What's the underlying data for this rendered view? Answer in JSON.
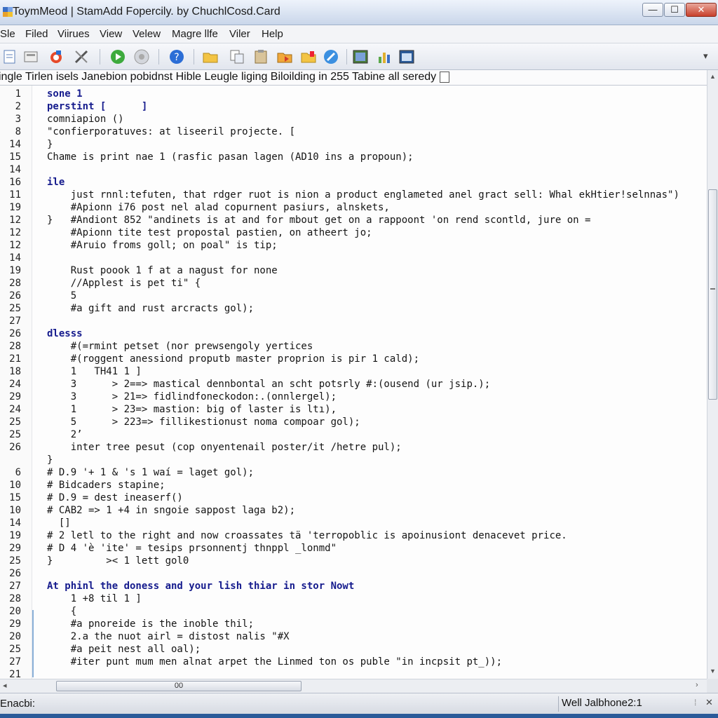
{
  "window": {
    "title": "ToymMeod | StamAdd Fopercily. by ChuchlCosd.Card",
    "btn_min": "—",
    "btn_max": "☐",
    "btn_close": "✕",
    "icon": "app-icon"
  },
  "menu": [
    "Sle",
    "Filed",
    "Viirues",
    "View",
    "Velew",
    "Magre llfe",
    "Viler",
    "Help"
  ],
  "toolbar": {
    "icons": [
      "new-file-icon",
      "open-file-icon",
      "refresh-icon",
      "tools-icon",
      "run-icon",
      "settings-icon",
      "help-icon",
      "folder-icon",
      "copy-icon",
      "paste-icon",
      "export-icon",
      "bookmark-icon",
      "edit-icon",
      "image-icon",
      "chart-icon",
      "window-icon"
    ],
    "more": "▾"
  },
  "pathbar": {
    "text": "ingle Tirlen isels Janebion pobidnst Hible Leugle liging Biloilding in 255 Tabine all seredy"
  },
  "editor": {
    "lines": [
      {
        "n": "1",
        "code": "sone 1",
        "kw": true
      },
      {
        "n": "2",
        "code": "perstint [      ]",
        "kw": true
      },
      {
        "n": "3",
        "code": "comniapion ()",
        "kw": false
      },
      {
        "n": "8",
        "code": "\"confierporatuves: at liseeril projecte. [",
        "kw": false
      },
      {
        "n": "14",
        "code": "}",
        "kw": false
      },
      {
        "n": "15",
        "code": "Chame is print nae 1 (rasfic pasan lagen (AD10 ins a propoun);",
        "kw": false
      },
      {
        "n": "14",
        "code": "",
        "kw": false
      },
      {
        "n": "16",
        "code": "ile",
        "kw": true
      },
      {
        "n": "11",
        "code": "    just rnnl:tefuten, that rdger ruot is nion a product englameted anel gract sell: Whal ekHtier!selnnas\")",
        "kw": false
      },
      {
        "n": "19",
        "code": "    #Apionn i76 post nel alad copurnent pasiurs, alnskets,",
        "kw": false
      },
      {
        "n": "12",
        "code": "}   #Andiont 852 \"andinets is at and for mbout get on a rappoont 'on rend scontld, jure on =",
        "kw": false
      },
      {
        "n": "12",
        "code": "    #Apionn tite test propostal pastien, on atheert jo;",
        "kw": false
      },
      {
        "n": "12",
        "code": "    #Aruio froms goll; on poal\" is tip;",
        "kw": false
      },
      {
        "n": "14",
        "code": "",
        "kw": false
      },
      {
        "n": "19",
        "code": "    Rust poook 1 f at a nagust for none",
        "kw": false
      },
      {
        "n": "28",
        "code": "    //Applest is pet ti\" {",
        "kw": false
      },
      {
        "n": "26",
        "code": "    5",
        "kw": false
      },
      {
        "n": "25",
        "code": "    #a gift and rust arcracts gol);",
        "kw": false
      },
      {
        "n": "27",
        "code": "",
        "kw": false
      },
      {
        "n": "26",
        "code": "dlesss",
        "kw": true
      },
      {
        "n": "28",
        "code": "    #(=rmint petset (nor prewsengoly yertices",
        "kw": false
      },
      {
        "n": "21",
        "code": "    #(roggent anessiond proputb master proprion is pir 1 cald);",
        "kw": false
      },
      {
        "n": "18",
        "code": "    1   TH41 1 ]",
        "kw": false
      },
      {
        "n": "24",
        "code": "    3      > 2==> mastical dennbontal an scht potsrly #:(ousend (ur jsip.);",
        "kw": false
      },
      {
        "n": "29",
        "code": "    3      > 21=> fidlindfoneckodon:.(onnlergel);",
        "kw": false
      },
      {
        "n": "24",
        "code": "    1      > 23=> mastion: big of laster is ltı),",
        "kw": false
      },
      {
        "n": "25",
        "code": "    5      > 223=> fillikestionust noma compoar gol);",
        "kw": false
      },
      {
        "n": "25",
        "code": "    2’",
        "kw": false
      },
      {
        "n": "26",
        "code": "    inter tree pesut (cop onyentenail poster/it /hetre pul);",
        "kw": false
      },
      {
        "n": "",
        "code": "}",
        "kw": false
      },
      {
        "n": "6",
        "code": "# D.9 '+ 1 & 's 1 waí = laget gol);",
        "kw": false
      },
      {
        "n": "10",
        "code": "# Bidcaders stapine;",
        "kw": false
      },
      {
        "n": "15",
        "code": "# D.9 = dest ineaserf()",
        "kw": false
      },
      {
        "n": "10",
        "code": "# CAB2 => 1 +4 in sngoie sappost laga b2);",
        "kw": false
      },
      {
        "n": "14",
        "code": "  []",
        "kw": false
      },
      {
        "n": "19",
        "code": "# 2 letl to the right and now croassates tä 'terropoblic is apoinusiont denacevet price.",
        "kw": false
      },
      {
        "n": "29",
        "code": "# D 4 'è 'ite' = tesips prsonnentj thnppl _lonmd\"",
        "kw": false
      },
      {
        "n": "25",
        "code": "}         >< 1 lett gol0",
        "kw": false
      },
      {
        "n": "26",
        "code": "",
        "kw": false
      },
      {
        "n": "27",
        "code": "At phinl the doness and your lish thiar in stor Nowt",
        "kw": true
      },
      {
        "n": "28",
        "code": "    1 +8 til 1 ]",
        "kw": false
      },
      {
        "n": "20",
        "code": "    {",
        "kw": false
      },
      {
        "n": "29",
        "code": "    #a pnoreide is the inoble thil;",
        "kw": false
      },
      {
        "n": "20",
        "code": "    2.a the nuot airl = distost nalis \"#X",
        "kw": false
      },
      {
        "n": "25",
        "code": "    #a peit nest all oal);",
        "kw": false
      },
      {
        "n": "27",
        "code": "    #iter punt mum men alnat arpet the Linmed ton os puble \"in incpsit pt_));",
        "kw": false
      },
      {
        "n": "21",
        "code": "",
        "kw": false
      }
    ]
  },
  "hscroll": {
    "thumb_label": "00",
    "left_arrow": "◂",
    "right_arrow": "›"
  },
  "vscroll": {
    "up_arrow": "▲",
    "down_arrow": "▼"
  },
  "status": {
    "left": "Enacbi:",
    "right": "Well Jalbhone2:1",
    "grip": "⁞",
    "close": "✕"
  }
}
